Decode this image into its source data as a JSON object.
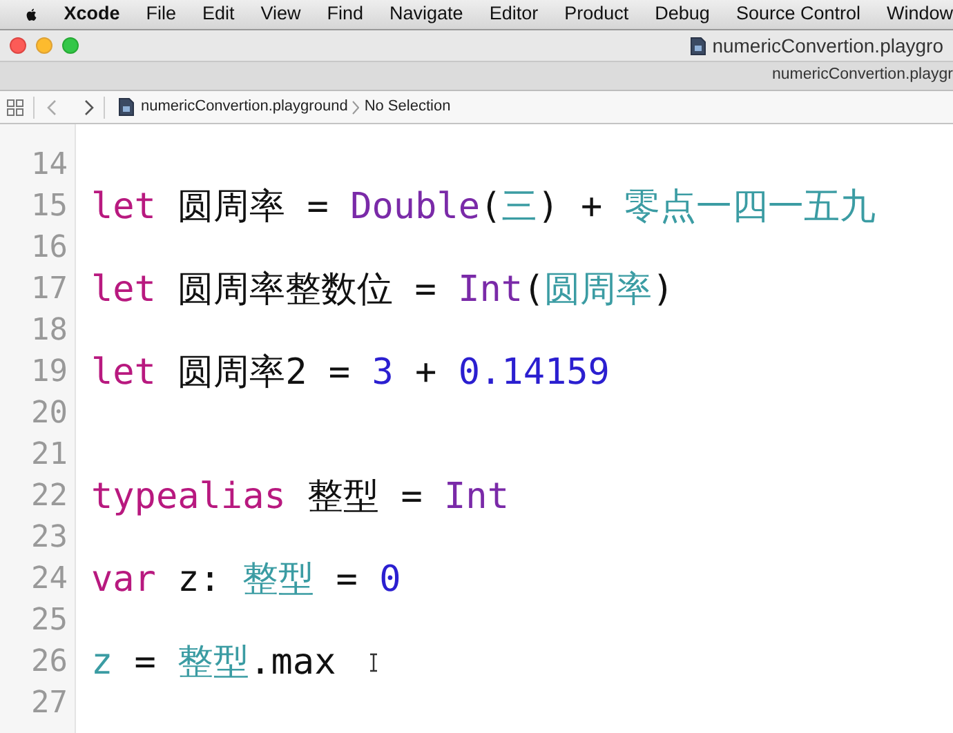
{
  "menu_bar": {
    "app": "Xcode",
    "items": [
      "File",
      "Edit",
      "View",
      "Find",
      "Navigate",
      "Editor",
      "Product",
      "Debug",
      "Source Control",
      "Window"
    ]
  },
  "window": {
    "title": "numericConvertion.playgro"
  },
  "tab": {
    "label": "numericConvertion.playgr"
  },
  "jump_bar": {
    "file": "numericConvertion.playground",
    "selection": "No Selection"
  },
  "editor": {
    "lines": [
      {
        "number": "14"
      },
      {
        "number": "15",
        "tokens": [
          {
            "text": "let",
            "kind": "keyword"
          },
          {
            "text": " 圆周率 = ",
            "kind": "plain"
          },
          {
            "text": "Double",
            "kind": "type"
          },
          {
            "text": "(",
            "kind": "plain"
          },
          {
            "text": "三",
            "kind": "variable"
          },
          {
            "text": ") + ",
            "kind": "plain"
          },
          {
            "text": "零点一四一五九",
            "kind": "variable"
          }
        ]
      },
      {
        "number": "16"
      },
      {
        "number": "17",
        "tokens": [
          {
            "text": "let",
            "kind": "keyword"
          },
          {
            "text": " 圆周率整数位 = ",
            "kind": "plain"
          },
          {
            "text": "Int",
            "kind": "type"
          },
          {
            "text": "(",
            "kind": "plain"
          },
          {
            "text": "圆周率",
            "kind": "variable"
          },
          {
            "text": ")",
            "kind": "plain"
          }
        ]
      },
      {
        "number": "18"
      },
      {
        "number": "19",
        "tokens": [
          {
            "text": "let",
            "kind": "keyword"
          },
          {
            "text": " 圆周率2 = ",
            "kind": "plain"
          },
          {
            "text": "3",
            "kind": "number"
          },
          {
            "text": " + ",
            "kind": "plain"
          },
          {
            "text": "0.14159",
            "kind": "number"
          }
        ]
      },
      {
        "number": "20"
      },
      {
        "number": "21"
      },
      {
        "number": "22",
        "tokens": [
          {
            "text": "typealias",
            "kind": "keyword"
          },
          {
            "text": " 整型 = ",
            "kind": "plain"
          },
          {
            "text": "Int",
            "kind": "type"
          }
        ]
      },
      {
        "number": "23"
      },
      {
        "number": "24",
        "tokens": [
          {
            "text": "var",
            "kind": "keyword"
          },
          {
            "text": " z: ",
            "kind": "plain"
          },
          {
            "text": "整型",
            "kind": "variable"
          },
          {
            "text": " = ",
            "kind": "plain"
          },
          {
            "text": "0",
            "kind": "number"
          }
        ]
      },
      {
        "number": "25"
      },
      {
        "number": "26",
        "tokens": [
          {
            "text": "z",
            "kind": "variable"
          },
          {
            "text": " = ",
            "kind": "plain"
          },
          {
            "text": "整型",
            "kind": "variable"
          },
          {
            "text": ".max",
            "kind": "plain"
          }
        ],
        "cursor": true
      },
      {
        "number": "27"
      }
    ]
  }
}
